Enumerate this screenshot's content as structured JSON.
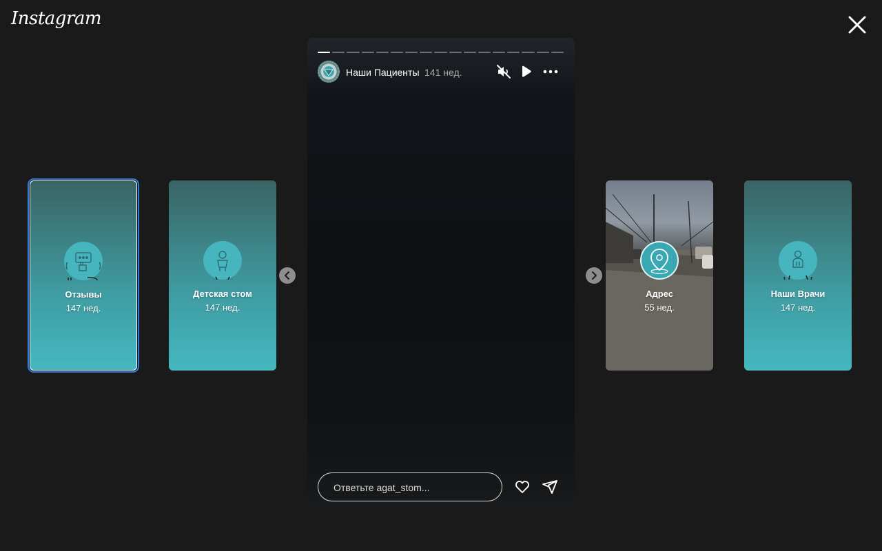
{
  "app": {
    "logo_text": "Instagram"
  },
  "left_cards": [
    {
      "title": "Отзывы",
      "time": "147 нед.",
      "icon": "thumbs-up-review-icon",
      "selected": true
    },
    {
      "title": "Детская стом",
      "time": "147 нед.",
      "icon": "child-icon"
    }
  ],
  "right_cards": [
    {
      "title": "Адрес",
      "time": "55 нед.",
      "icon": "location-pin-icon"
    },
    {
      "title": "Наши Врачи",
      "time": "147 нед.",
      "icon": "doctor-icon"
    }
  ],
  "story": {
    "username": "Наши Пациенты",
    "age": "141 нед.",
    "segments_total": 17,
    "active_segment": 1,
    "reply_placeholder": "Ответьте agat_stom..."
  },
  "colors": {
    "background": "#1a1a1a",
    "card_gradient_top": "#3a6464",
    "card_gradient_bottom": "#45b8c0",
    "selected_outline": "#2d79e0"
  }
}
